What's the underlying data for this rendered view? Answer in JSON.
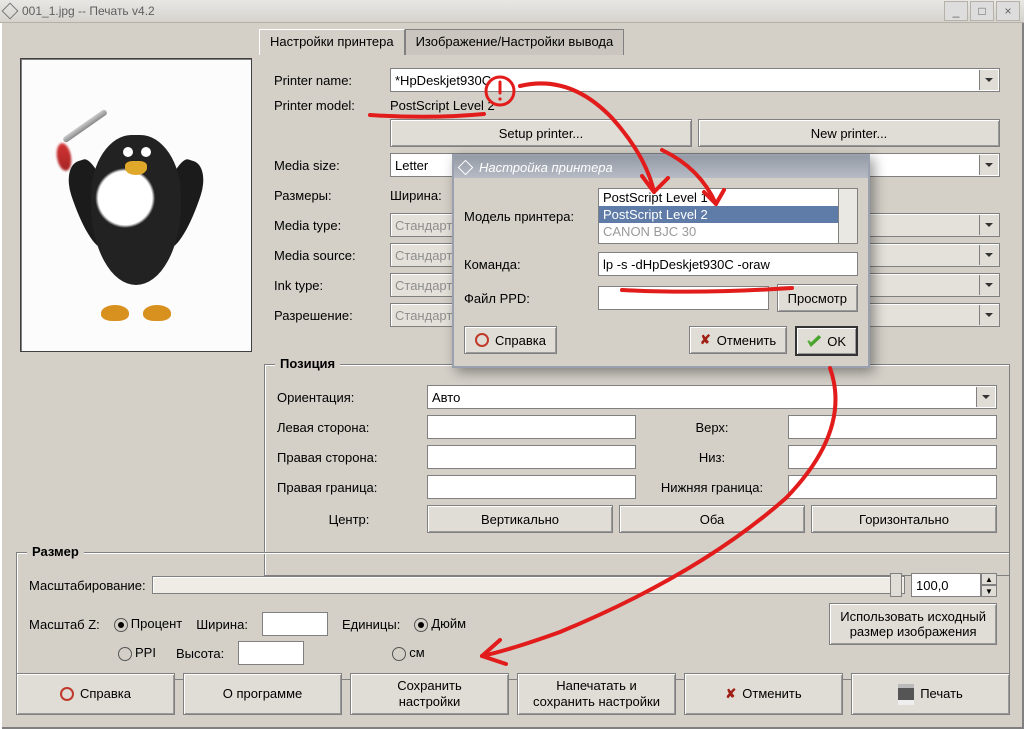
{
  "window": {
    "title": "001_1.jpg -- Печать v4.2"
  },
  "tabs": {
    "printer": "Настройки принтера",
    "image": "Изображение/Настройки вывода"
  },
  "printer": {
    "name_label": "Printer name:",
    "name_value": "*HpDeskjet930C",
    "model_label": "Printer model:",
    "model_value": "PostScript Level 2",
    "setup_btn": "Setup printer...",
    "new_btn": "New printer...",
    "media_size_label": "Media size:",
    "media_size_value": "Letter",
    "dims_label": "Размеры:",
    "width_label": "Ширина:",
    "media_type_label": "Media type:",
    "media_type_value": "Стандарт",
    "media_source_label": "Media source:",
    "media_source_value": "Стандарт",
    "ink_label": "Ink type:",
    "ink_value": "Стандарт",
    "res_label": "Разрешение:",
    "res_value": "Стандарт"
  },
  "position": {
    "legend": "Позиция",
    "orient_label": "Ориентация:",
    "orient_value": "Авто",
    "left_label": "Левая сторона:",
    "right_label": "Правая сторона:",
    "rborder_label": "Правая граница:",
    "top_label": "Верх:",
    "bottom_label": "Низ:",
    "bborder_label": "Нижняя граница:",
    "center_label": "Центр:",
    "vert_btn": "Вертикально",
    "both_btn": "Оба",
    "horz_btn": "Горизонтально"
  },
  "size": {
    "legend": "Размер",
    "scaling_label": "Масштабирование:",
    "scaling_value": "100,0",
    "scalez_label": "Масштаб Z:",
    "percent": "Процент",
    "ppi": "PPI",
    "width_label": "Ширина:",
    "height_label": "Высота:",
    "units_label": "Единицы:",
    "inch": "Дюйм",
    "cm": "см",
    "orig_btn": "Использовать исходный\nразмер изображения"
  },
  "bottombar": {
    "help": "Справка",
    "about": "О программе",
    "save": "Сохранить\nнастройки",
    "printsave": "Напечатать и\nсохранить настройки",
    "cancel": "Отменить",
    "print": "Печать"
  },
  "modal": {
    "title": "Настройка принтера",
    "model_label": "Модель принтера:",
    "opt1": "PostScript Level 1",
    "opt2": "PostScript Level 2",
    "opt3": "CANON BJC 30",
    "cmd_label": "Команда:",
    "cmd_value": "lp -s -dHpDeskjet930C -oraw",
    "ppd_label": "Файл PPD:",
    "browse": "Просмотр",
    "help": "Справка",
    "cancel": "Отменить",
    "ok": "OK"
  }
}
